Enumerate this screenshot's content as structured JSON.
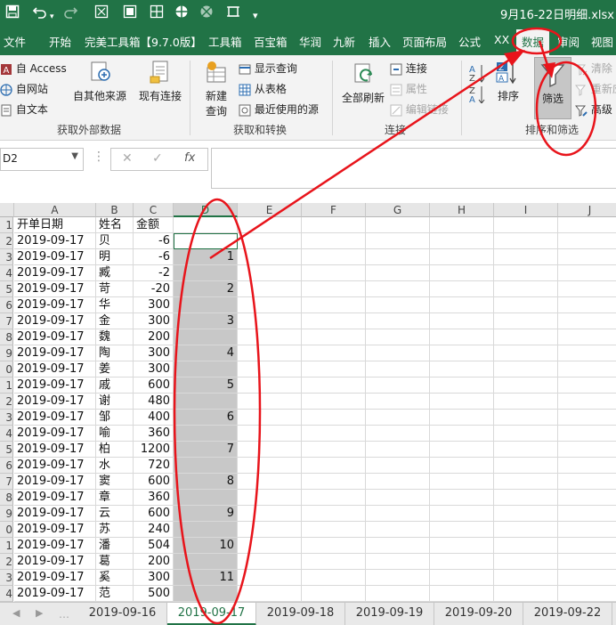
{
  "titlebar": {
    "title": "9月16-22日明细.xlsx",
    "icons": [
      "save-icon",
      "undo-icon",
      "redo-icon",
      "qat-tool-icon",
      "customize-qat-icon"
    ]
  },
  "tabs": [
    {
      "label": "文件"
    },
    {
      "label": "开始"
    },
    {
      "label": "完美工具箱【9.7.0版】"
    },
    {
      "label": "工具箱"
    },
    {
      "label": "百宝箱"
    },
    {
      "label": "华润"
    },
    {
      "label": "九新"
    },
    {
      "label": "插入"
    },
    {
      "label": "页面布局"
    },
    {
      "label": "公式"
    },
    {
      "label": "XX"
    },
    {
      "label": "数据"
    },
    {
      "label": "审阅"
    },
    {
      "label": "视图"
    }
  ],
  "active_tab": "数据",
  "ribbon": {
    "external": {
      "access": "自 Access",
      "web": "自网站",
      "text": "自文本",
      "other_sources": "自其他来源",
      "existing": "现有连接",
      "group": "获取外部数据"
    },
    "transform": {
      "new_query_l1": "新建",
      "new_query_l2": "查询",
      "show_queries": "显示查询",
      "from_table": "从表格",
      "recent_sources": "最近使用的源",
      "group": "获取和转换"
    },
    "connections": {
      "refresh_all": "全部刷新",
      "connections": "连接",
      "properties": "属性",
      "edit_links": "编辑链接",
      "group": "连接"
    },
    "sort_filter": {
      "sort": "排序",
      "filter": "筛选",
      "clear": "清除",
      "reapply": "重新应用",
      "advanced": "高级",
      "group": "排序和筛选"
    }
  },
  "formula_bar": {
    "name_box": "D2",
    "fx": "fx",
    "formula": ""
  },
  "columns": [
    "A",
    "B",
    "C",
    "D",
    "E",
    "F",
    "G",
    "H",
    "I",
    "J"
  ],
  "selected_column": "D",
  "rows": [
    {
      "n": "1",
      "a": "开单日期",
      "b": "姓名",
      "c": "金额",
      "d": ""
    },
    {
      "n": "2",
      "a": "2019-09-17",
      "b": "贝",
      "c": "-6",
      "d": ""
    },
    {
      "n": "3",
      "a": "2019-09-17",
      "b": "明",
      "c": "-6",
      "d": "1"
    },
    {
      "n": "4",
      "a": "2019-09-17",
      "b": "臧",
      "c": "-2",
      "d": ""
    },
    {
      "n": "5",
      "a": "2019-09-17",
      "b": "苛",
      "c": "-20",
      "d": "2"
    },
    {
      "n": "6",
      "a": "2019-09-17",
      "b": "华",
      "c": "300",
      "d": ""
    },
    {
      "n": "7",
      "a": "2019-09-17",
      "b": "金",
      "c": "300",
      "d": "3"
    },
    {
      "n": "8",
      "a": "2019-09-17",
      "b": "魏",
      "c": "200",
      "d": ""
    },
    {
      "n": "9",
      "a": "2019-09-17",
      "b": "陶",
      "c": "300",
      "d": "4"
    },
    {
      "n": "0",
      "a": "2019-09-17",
      "b": "姜",
      "c": "300",
      "d": ""
    },
    {
      "n": "1",
      "a": "2019-09-17",
      "b": "戚",
      "c": "600",
      "d": "5"
    },
    {
      "n": "2",
      "a": "2019-09-17",
      "b": "谢",
      "c": "480",
      "d": ""
    },
    {
      "n": "3",
      "a": "2019-09-17",
      "b": "邹",
      "c": "400",
      "d": "6"
    },
    {
      "n": "4",
      "a": "2019-09-17",
      "b": "喻",
      "c": "360",
      "d": ""
    },
    {
      "n": "5",
      "a": "2019-09-17",
      "b": "柏",
      "c": "1200",
      "d": "7"
    },
    {
      "n": "6",
      "a": "2019-09-17",
      "b": "水",
      "c": "720",
      "d": ""
    },
    {
      "n": "7",
      "a": "2019-09-17",
      "b": "窦",
      "c": "600",
      "d": "8"
    },
    {
      "n": "8",
      "a": "2019-09-17",
      "b": "章",
      "c": "360",
      "d": ""
    },
    {
      "n": "9",
      "a": "2019-09-17",
      "b": "云",
      "c": "600",
      "d": "9"
    },
    {
      "n": "0",
      "a": "2019-09-17",
      "b": "苏",
      "c": "240",
      "d": ""
    },
    {
      "n": "1",
      "a": "2019-09-17",
      "b": "潘",
      "c": "504",
      "d": "10"
    },
    {
      "n": "2",
      "a": "2019-09-17",
      "b": "葛",
      "c": "200",
      "d": ""
    },
    {
      "n": "3",
      "a": "2019-09-17",
      "b": "奚",
      "c": "300",
      "d": "11"
    },
    {
      "n": "4",
      "a": "2019-09-17",
      "b": "范",
      "c": "500",
      "d": ""
    }
  ],
  "sheet_tabs": [
    "2019-09-16",
    "2019-09-17",
    "2019-09-18",
    "2019-09-19",
    "2019-09-20",
    "2019-09-22"
  ],
  "active_sheet": "2019-09-17",
  "colors": {
    "brand": "#217346",
    "annotation": "#e8141b",
    "filter_column": "#c8c8c8"
  }
}
